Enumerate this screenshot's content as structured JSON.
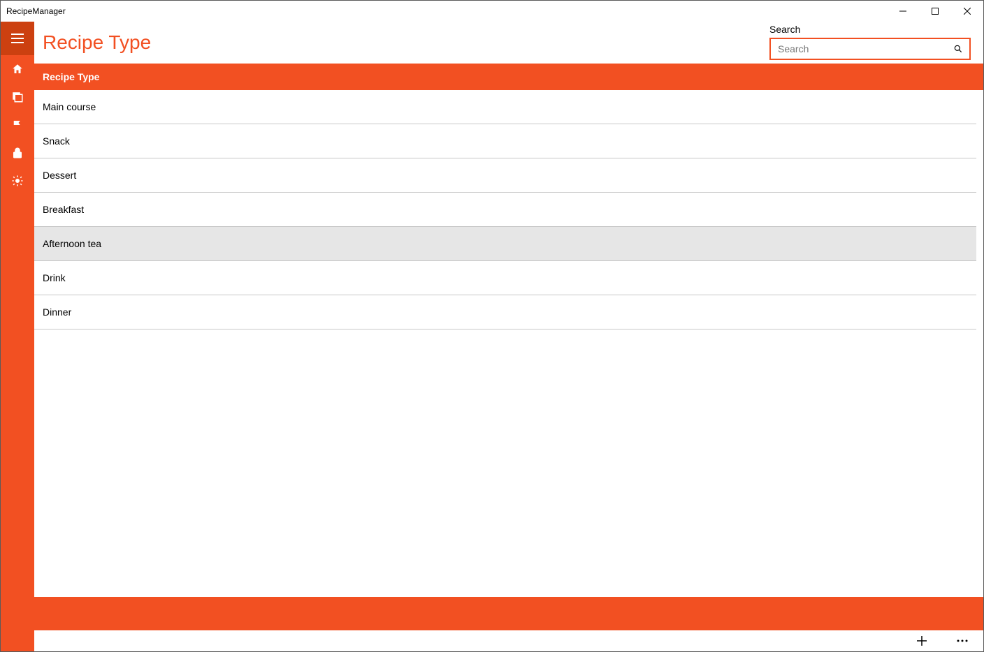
{
  "window": {
    "title": "RecipeManager"
  },
  "header": {
    "page_title": "Recipe Type",
    "search_label": "Search",
    "search_placeholder": "Search"
  },
  "section": {
    "title": "Recipe Type"
  },
  "rail": {
    "icons": [
      "hamburger",
      "home",
      "categories",
      "flag",
      "lock",
      "settings"
    ]
  },
  "list": {
    "items": [
      {
        "label": "Main course",
        "hover": false
      },
      {
        "label": "Snack",
        "hover": false
      },
      {
        "label": "Dessert",
        "hover": false
      },
      {
        "label": "Breakfast",
        "hover": false
      },
      {
        "label": "Afternoon tea",
        "hover": true
      },
      {
        "label": "Drink",
        "hover": false
      },
      {
        "label": "Dinner",
        "hover": false
      }
    ]
  },
  "commands": {
    "add": "Add",
    "more": "More"
  },
  "colors": {
    "accent": "#F25022",
    "accent_dark": "#CC4010"
  }
}
